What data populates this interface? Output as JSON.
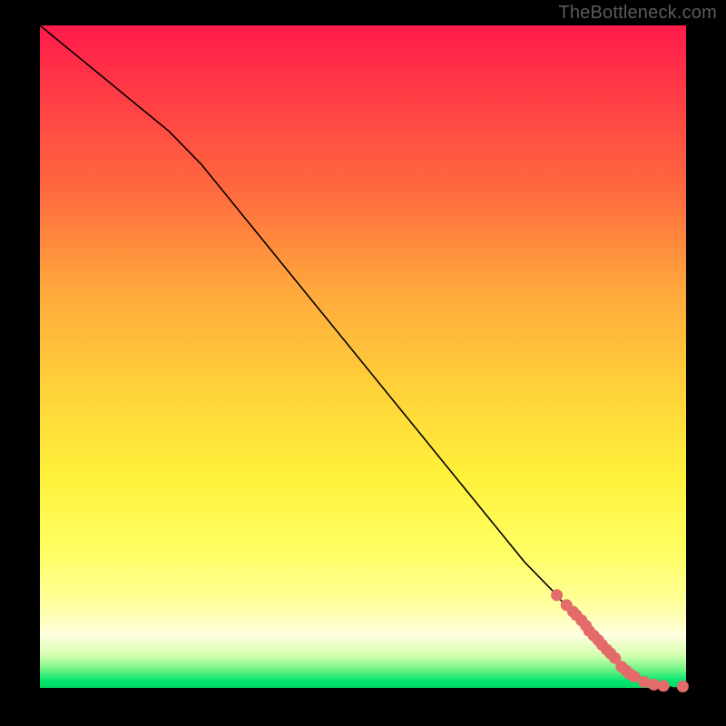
{
  "watermark": "TheBottleneck.com",
  "chart_data": {
    "type": "line",
    "title": "",
    "xlabel": "",
    "ylabel": "",
    "xlim": [
      0,
      100
    ],
    "ylim": [
      0,
      100
    ],
    "grid": false,
    "series": [
      {
        "name": "bottleneck-curve",
        "x": [
          0,
          5,
          10,
          15,
          20,
          25,
          30,
          35,
          40,
          45,
          50,
          55,
          60,
          65,
          70,
          75,
          80,
          85,
          88,
          90,
          92,
          94,
          96,
          98,
          100
        ],
        "y": [
          100,
          96,
          92,
          88,
          84,
          79,
          73,
          67,
          61,
          55,
          49,
          43,
          37,
          31,
          25,
          19,
          14,
          8,
          5,
          3,
          2,
          1,
          0.5,
          0,
          0
        ]
      }
    ],
    "scatter": {
      "name": "highlighted-points",
      "x": [
        80,
        81.5,
        82.5,
        83,
        83.8,
        84.5,
        85,
        85.7,
        86.4,
        87,
        87.7,
        88.3,
        89,
        90,
        90.7,
        91.3,
        92,
        93.5,
        95,
        96.5,
        99.5
      ],
      "y": [
        14,
        12.5,
        11.5,
        11,
        10.2,
        9.4,
        8.6,
        7.9,
        7.2,
        6.5,
        5.8,
        5.2,
        4.5,
        3.2,
        2.6,
        2.1,
        1.7,
        0.9,
        0.5,
        0.3,
        0.2
      ]
    },
    "colors": {
      "curve": "#000000",
      "dot": "#e56a6a",
      "gradient_top": "#ff1a4b",
      "gradient_mid": "#ffe838",
      "gradient_bottom": "#00d860"
    }
  }
}
